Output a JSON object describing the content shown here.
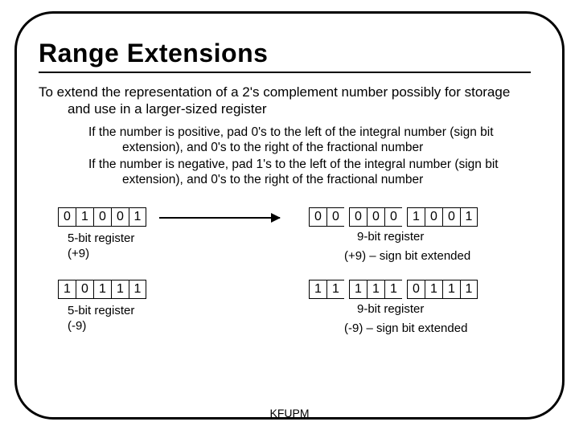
{
  "title": "Range Extensions",
  "intro": "To extend the representation of a 2's complement number possibly for storage and use in a larger-sized register",
  "rule_pos": "If the number is positive, pad 0's to the left of the integral number (sign bit extension), and 0's to the right of the fractional number",
  "rule_neg": "If the number is negative, pad 1's to the left of the integral number (sign bit extension), and 0's to the right of the fractional number",
  "reg5_pos": {
    "bits": [
      "0",
      "1",
      "0",
      "0",
      "1"
    ],
    "caption_l1": "5-bit register",
    "caption_l2": "(+9)"
  },
  "reg9_pos": {
    "bits_a": [
      "0",
      "0"
    ],
    "bits_b": [
      "0",
      "0",
      "0"
    ],
    "bits_c": [
      "1",
      "0",
      "0",
      "1"
    ],
    "caption_l1": "9-bit register",
    "caption_l2": "(+9) – sign bit extended"
  },
  "reg5_neg": {
    "bits": [
      "1",
      "0",
      "1",
      "1",
      "1"
    ],
    "caption_l1": "5-bit register",
    "caption_l2": "(-9)"
  },
  "reg9_neg": {
    "bits_a": [
      "1",
      "1"
    ],
    "bits_b": [
      "1",
      "1",
      "1"
    ],
    "bits_c": [
      "0",
      "1",
      "1",
      "1"
    ],
    "caption_l1": "9-bit register",
    "caption_l2": "(-9) – sign bit extended"
  },
  "footer": "KFUPM"
}
